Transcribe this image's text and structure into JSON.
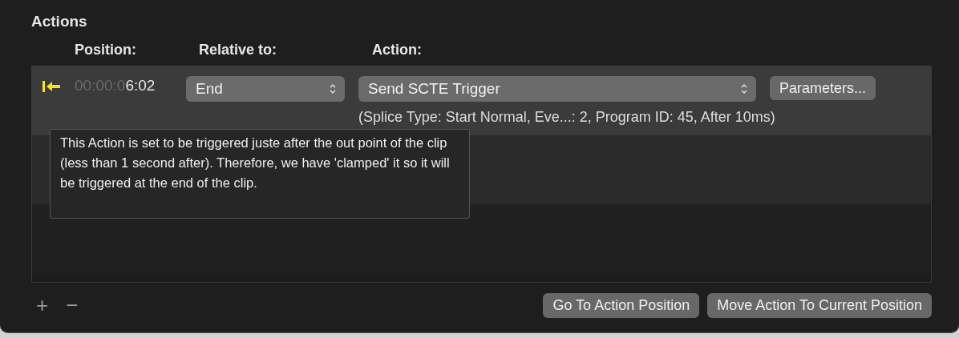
{
  "section_title": "Actions",
  "columns": [
    "Position:",
    "Relative to:",
    "Action:"
  ],
  "rows": [
    {
      "clamped": true,
      "selected": true,
      "position_dim": "00:00:0",
      "position": "6:02",
      "relative_to": "End",
      "action": "Send SCTE Trigger",
      "parameters_button": "Parameters...",
      "summary": "(Splice Type: Start Normal, Eve...: 2, Program ID: 45, After 10ms)"
    }
  ],
  "tooltip": "This Action is set to be triggered juste after the out point of the clip (less than 1 second after). Therefore, we have 'clamped' it so it will be triggered at the end of the clip.",
  "add_button": "+",
  "remove_button": "−",
  "buttons": [
    "Go To Action Position",
    "Move Action To Current Position"
  ]
}
